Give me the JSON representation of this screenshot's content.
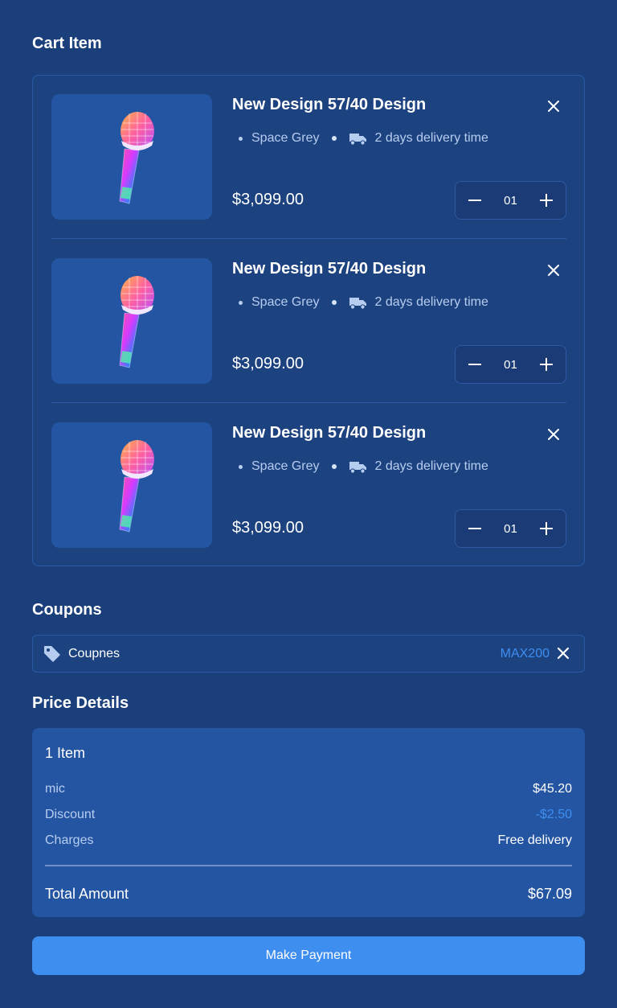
{
  "cart": {
    "title": "Cart Item",
    "items": [
      {
        "title": "New Design 57/40 Design",
        "color": "Space Grey",
        "delivery": "2 days delivery time",
        "price": "$3,099.00",
        "qty": "01"
      },
      {
        "title": "New Design 57/40 Design",
        "color": "Space Grey",
        "delivery": "2 days delivery time",
        "price": "$3,099.00",
        "qty": "01"
      },
      {
        "title": "New Design 57/40 Design",
        "color": "Space Grey",
        "delivery": "2 days delivery time",
        "price": "$3,099.00",
        "qty": "01"
      }
    ]
  },
  "coupons": {
    "title": "Coupons",
    "label": "Coupnes",
    "code": "MAX200"
  },
  "price_details": {
    "title": "Price Details",
    "header": "1 Item",
    "rows": [
      {
        "label": "mic",
        "value": "$45.20"
      },
      {
        "label": "Discount",
        "value": "-$2.50"
      },
      {
        "label": "Charges",
        "value": "Free delivery"
      }
    ],
    "total_label": "Total Amount",
    "total_value": "$67.09"
  },
  "payment": {
    "button_label": "Make Payment"
  },
  "colors": {
    "background": "#1b3f7b",
    "card": "#2455a3",
    "accent": "#3e8ef0",
    "muted_text": "#b7cdf0"
  },
  "icons": [
    "microphone-image",
    "close-icon",
    "truck-icon",
    "minus-icon",
    "plus-icon",
    "tag-icon"
  ]
}
